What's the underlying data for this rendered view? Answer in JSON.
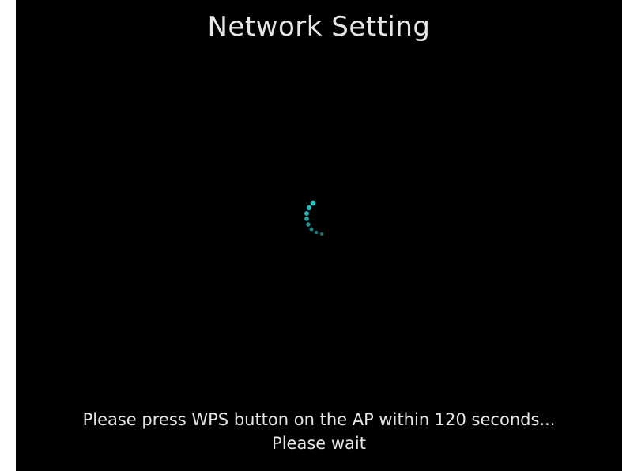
{
  "screen": {
    "title": "Network Setting",
    "loading_icon": "spinner-icon",
    "message_line1": "Please press WPS button on the AP within 120 seconds...",
    "message_line2": "Please wait"
  },
  "colors": {
    "background": "#000000",
    "text": "#e6e6e6",
    "spinner": "#2bb3b3"
  }
}
